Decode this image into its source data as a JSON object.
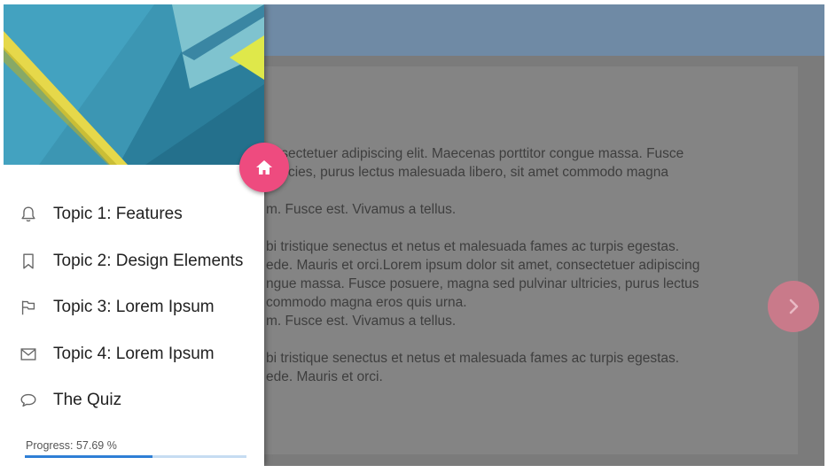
{
  "colors": {
    "header": "#6f8aa5",
    "overlay_content": "#7b7b7b",
    "accent_fab": "#ee4b7f",
    "progress_fill": "#2f7fd6",
    "progress_track": "#c6dcf2"
  },
  "content": {
    "text_lines": [
      "onsectetuer adipiscing elit. Maecenas porttitor congue massa. Fusce",
      "ultricies, purus lectus malesuada libero, sit amet commodo magna",
      "",
      "m. Fusce est. Vivamus a tellus.",
      "",
      "bi tristique senectus et netus et malesuada fames ac turpis egestas.",
      "ede. Mauris et orci.Lorem ipsum dolor sit amet, consectetuer adipiscing",
      "ngue massa. Fusce posuere, magna sed pulvinar ultricies, purus lectus",
      "commodo magna eros quis urna.",
      "m. Fusce est. Vivamus a tellus.",
      "",
      "bi tristique senectus et netus et malesuada fames ac turpis egestas.",
      "ede. Mauris et orci."
    ],
    "next_icon": "chevron-right-icon"
  },
  "drawer": {
    "home_icon": "home-icon",
    "topics": [
      {
        "label": "Topic 1: Features",
        "icon": "bell-icon"
      },
      {
        "label": "Topic 2: Design Elements",
        "icon": "bookmark-icon"
      },
      {
        "label": "Topic 3: Lorem Ipsum",
        "icon": "flag-icon"
      },
      {
        "label": "Topic 4: Lorem Ipsum",
        "icon": "mail-icon"
      },
      {
        "label": "The Quiz",
        "icon": "chat-bubble-icon"
      }
    ],
    "progress": {
      "label": "Progress: 57.69 %",
      "value": 0.5769
    }
  }
}
